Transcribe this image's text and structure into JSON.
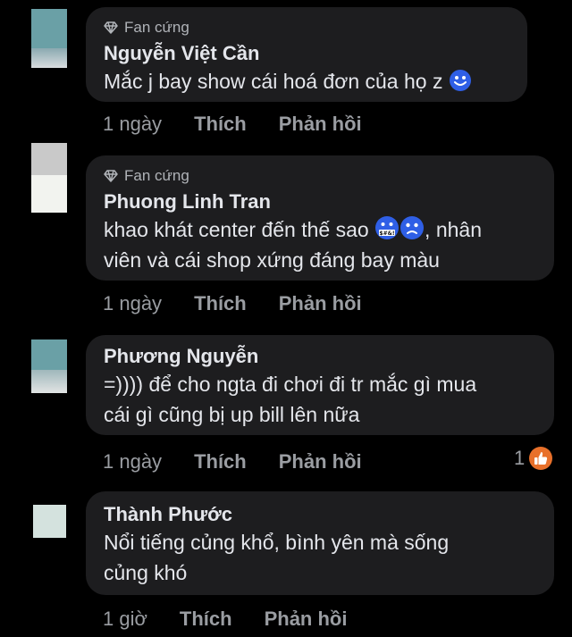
{
  "comments": [
    {
      "badge": "Fan cứng",
      "author": "Nguyễn Việt Cần",
      "text": "Mắc j bay show cái hoá đơn của họ z",
      "time": "1 ngày",
      "like_label": "Thích",
      "reply_label": "Phản hồi"
    },
    {
      "badge": "Fan cứng",
      "author": "Phuong Linh Tran",
      "text_line1": "khao khát center đến thế sao",
      "text_line1_after": ", nhân",
      "text_line2": "viên và cái shop xứng đáng bay màu",
      "time": "1 ngày",
      "like_label": "Thích",
      "reply_label": "Phản hồi"
    },
    {
      "author": "Phương Nguyễn",
      "text_line1": "=)))) để cho ngta đi chơi đi tr mắc gì mua",
      "text_line2": "cái gì cũng bị up bill lên nữa",
      "time": "1 ngày",
      "like_label": "Thích",
      "reply_label": "Phản hồi",
      "reaction_count": "1"
    },
    {
      "author": "Thành Phước",
      "text_line1": "Nổi tiếng củng khổ, bình yên mà sống",
      "text_line2": "củng khó",
      "time": "1 giờ",
      "like_label": "Thích",
      "reply_label": "Phản hồi"
    }
  ],
  "icons": {
    "badge": "diamond-icon",
    "emoji1": "smiling-face-icon",
    "emoji2a": "cursing-face-icon",
    "emoji2b": "sad-face-icon",
    "reaction": "like-icon"
  },
  "colors": {
    "background": "#000000",
    "bubble": "#1d1d1f",
    "text": "#e4e6eb",
    "muted": "#9a9da2",
    "like_reaction": "#e8702a"
  }
}
